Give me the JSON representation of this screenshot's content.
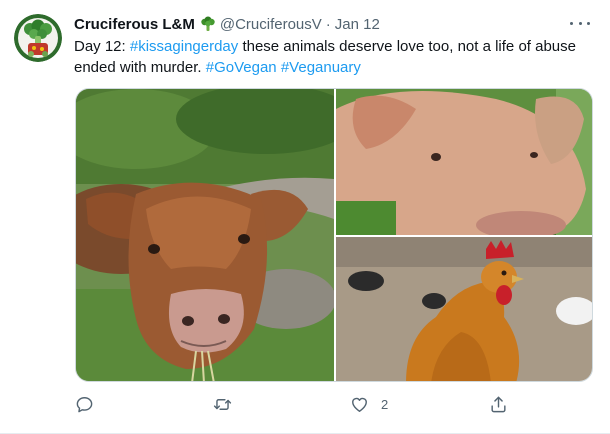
{
  "tweet": {
    "display_name": "Cruciferous L&M",
    "handle": "@CruciferousV",
    "separator": "·",
    "date": "Jan 12",
    "text_prefix": "Day 12: ",
    "hashtag_1": "#kissagingerday",
    "text_middle": " these animals deserve love too, not a life of abuse ended with murder. ",
    "hashtag_2": "#GoVegan",
    "hashtag_3": "#Veganuary",
    "name_emoji": "broccoli-icon"
  },
  "media": {
    "images": [
      "cow",
      "pig",
      "hen"
    ]
  },
  "actions": {
    "reply_count": "",
    "retweet_count": "",
    "like_count": "2",
    "icons": [
      "reply-icon",
      "retweet-icon",
      "like-icon",
      "share-icon"
    ]
  },
  "colors": {
    "link": "#1d9bf0",
    "secondary": "#536471",
    "primary": "#0f1419",
    "border": "#cfd9de"
  }
}
